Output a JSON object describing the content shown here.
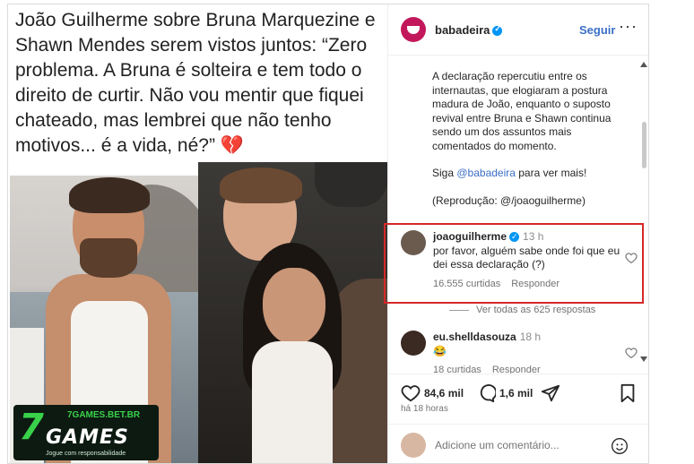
{
  "headline": {
    "text": "João Guilherme sobre Bruna Marquezine e Shawn Mendes serem vistos juntos: “Zero problema. A Bruna é solteira e tem todo o direito de curtir. Não vou mentir que fiquei chateado, mas lembrei que não tenho motivos... é a vida, né?” 💔"
  },
  "watermark": {
    "seven": "7",
    "games": "GAMES",
    "domain": "7GAMES.BET.BR",
    "note": "Jogue com responsabilidade"
  },
  "header": {
    "username": "babadeira",
    "follow_label": "Seguir",
    "more_icon": "more-horizontal-icon",
    "more_label": "···"
  },
  "caption": {
    "text": "A declaração repercutiu entre os internautas, que elogiaram a postura madura de João, enquanto o suposto revival entre Bruna e Shawn continua sendo um dos assuntos mais comentados do momento.",
    "cta_prefix": "Siga ",
    "cta_mention": "@babadeira",
    "cta_suffix": " para ver mais!",
    "credit": "(Reprodução: @/joaoguilherme)"
  },
  "comments": [
    {
      "username": "joaoguilherme",
      "time": "13 h",
      "text": "por favor, alguém sabe onde foi que eu dei essa declaração (?)",
      "likes": "16.555 curtidas",
      "reply": "Responder"
    },
    {
      "username": "eu.shelldasouza",
      "time": "18 h",
      "text": "😂",
      "likes": "18 curtidas",
      "reply": "Responder"
    }
  ],
  "view_replies": "Ver todas as 625 respostas",
  "actions": {
    "likes": "84,6 mil",
    "comments": "1,6 mil"
  },
  "date": "há 18 horas",
  "add_comment": {
    "placeholder": "Adicione um comentário..."
  },
  "colors": {
    "accent": "#3b6fc7",
    "verified": "#0095f6",
    "highlight": "#d62728"
  }
}
